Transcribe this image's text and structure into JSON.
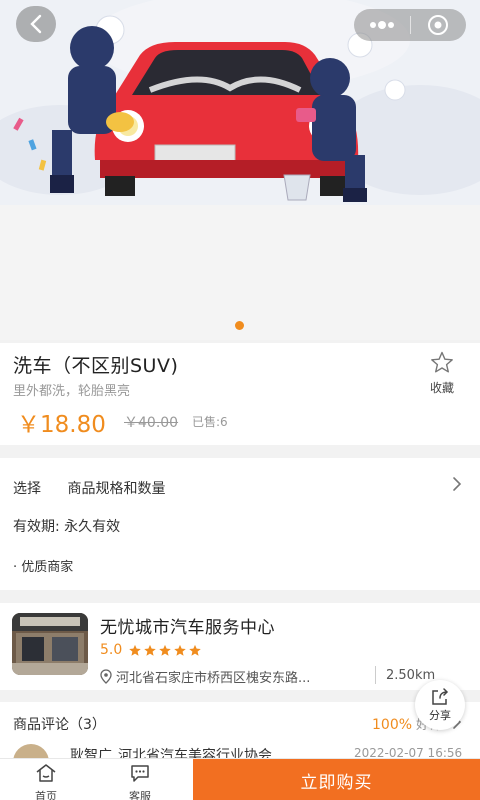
{
  "colors": {
    "accent": "#f08c1e",
    "buy_button": "#f26f21",
    "car_red": "#e8303a",
    "worker_navy": "#2b3a6b"
  },
  "header": {
    "back_icon": "chevron-left-icon",
    "menu_icon": "more-dots-icon",
    "close_icon": "target-close-icon"
  },
  "banner": {
    "slide_count": 1,
    "active_slide": 1
  },
  "product": {
    "title": "洗车（不区别SUV)",
    "subtitle": "里外都洗，轮胎黑亮",
    "price": "￥18.80",
    "original_price": "￥40.00",
    "sold": "已售:6",
    "favorite_label": "收藏",
    "favorite_icon": "star-outline-icon"
  },
  "options": {
    "select_key": "选择",
    "select_value": "商品规格和数量",
    "validity": "有效期:  永久有效",
    "merchant_tag": "· 优质商家"
  },
  "store": {
    "name": "无忧城市汽车服务中心",
    "rating": "5.0",
    "stars": 5,
    "address": "河北省石家庄市桥西区槐安东路...",
    "distance": "2.50km"
  },
  "share": {
    "label": "分享",
    "icon": "share-icon"
  },
  "reviews": {
    "title": "商品评论（3）",
    "good_rate": "100%",
    "good_label": "好评",
    "first_user": "耿智广",
    "first_org": "河北省汽车美容行业协会",
    "first_time": "2022-02-07 16:56"
  },
  "bottom_bar": {
    "home_label": "首页",
    "service_label": "客服",
    "buy_label": "立即购买"
  }
}
